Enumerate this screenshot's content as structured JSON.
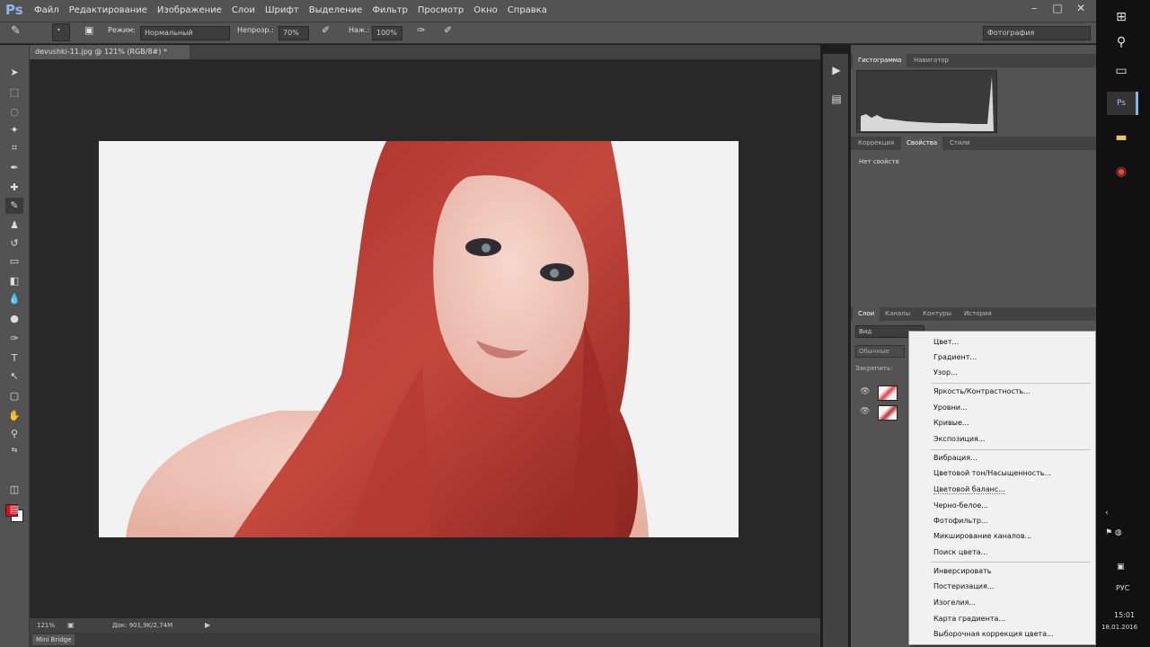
{
  "app": {
    "logo": "Ps",
    "menu": [
      "Файл",
      "Редактирование",
      "Изображение",
      "Слои",
      "Шрифт",
      "Выделение",
      "Фильтр",
      "Просмотр",
      "Окно",
      "Справка"
    ],
    "window_controls": [
      "–",
      "□",
      "✕"
    ]
  },
  "options_bar": {
    "mode_label": "Режим:",
    "mode_value": "Нормальный",
    "opacity_label": "Непрозр.:",
    "opacity_value": "70%",
    "flow_label": "Наж.:",
    "flow_value": "100%",
    "workspace": "Фотография"
  },
  "document": {
    "tab_title": "devushki-11.jpg @ 121% (RGB/8#) *",
    "zoom": "121%",
    "doc_info": "Док: 901,9K/2,74M"
  },
  "bridge": {
    "label": "Mini Bridge"
  },
  "panels": {
    "top_tabs": [
      "Гистограмма",
      "Навигатор"
    ],
    "mid_tabs": [
      "Коррекция",
      "Свойства",
      "Стили"
    ],
    "props_text": "Нет свойств",
    "layers_tabs": [
      "Слои",
      "Каналы",
      "Контуры",
      "История"
    ],
    "layers_kind": "Вид",
    "layers_blend": "Обычные",
    "layers_lock": "Закрепить:"
  },
  "adjust_menu": {
    "groups": [
      [
        "Цвет...",
        "Градиент...",
        "Узор..."
      ],
      [
        "Яркость/Контрастность...",
        "Уровни...",
        "Кривые...",
        "Экспозиция..."
      ],
      [
        "Вибрация...",
        "Цветовой тон/Насыщенность...",
        "Цветовой баланс...",
        "Черно-белое...",
        "Фотофильтр...",
        "Микширование каналов...",
        "Поиск цвета..."
      ],
      [
        "Инверсировать",
        "Постеризация...",
        "Изогелия...",
        "Карта градиента...",
        "Выборочная коррекция цвета..."
      ]
    ]
  },
  "taskbar": {
    "apps": [
      "Ps"
    ],
    "lang": "РУС",
    "time": "15:01",
    "date": "18.01.2016"
  },
  "colors": {
    "foreground": "#e00d1f",
    "background": "#ffffff",
    "accent": "#86b4e0"
  }
}
